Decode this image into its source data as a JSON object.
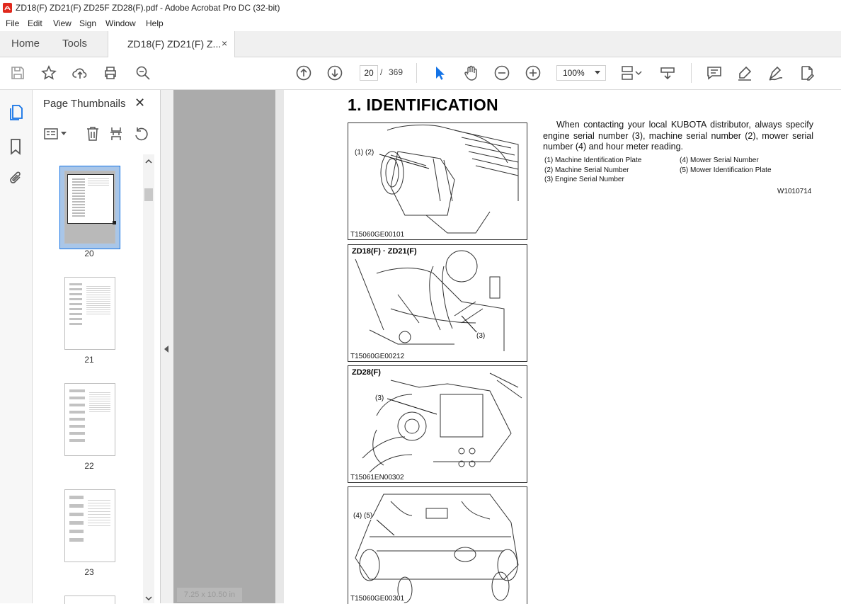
{
  "window": {
    "title": "ZD18(F) ZD21(F) ZD25F ZD28(F).pdf - Adobe Acrobat Pro DC (32-bit)"
  },
  "menu": [
    "File",
    "Edit",
    "View",
    "Sign",
    "Window",
    "Help"
  ],
  "tabs": {
    "home": "Home",
    "tools": "Tools",
    "document": "ZD18(F) ZD21(F) Z...",
    "close": "×"
  },
  "toolbar": {
    "current_page": "20",
    "separator": "/",
    "total_pages": "369",
    "zoom": "100%"
  },
  "sidebar": {
    "title": "Page Thumbnails",
    "close": "✕",
    "thumbnails": [
      {
        "label": "20",
        "selected": true
      },
      {
        "label": "21",
        "selected": false
      },
      {
        "label": "22",
        "selected": false
      },
      {
        "label": "23",
        "selected": false
      }
    ]
  },
  "document": {
    "heading": "1.  IDENTIFICATION",
    "intro": "When contacting your local KUBOTA distributor, always specify engine serial number (3), machine serial number (2), mower serial number (4) and hour meter reading.",
    "legend_left": [
      "(1)  Machine Identification Plate",
      "(2)  Machine Serial Number",
      "(3)  Engine Serial Number"
    ],
    "legend_right": [
      "(4)  Mower Serial Number",
      "(5)  Mower Identification Plate"
    ],
    "ref_code": "W1010714",
    "figures": [
      {
        "tag": "",
        "callout": "(1) (2)",
        "caption": "T15060GE00101"
      },
      {
        "tag": "ZD18(F) · ZD21(F)",
        "callout": "(3)",
        "caption": "T15060GE00212"
      },
      {
        "tag": "ZD28(F)",
        "callout": "(3)",
        "caption": "T15061EN00302"
      },
      {
        "tag": "",
        "callout": "(4) (5)",
        "caption": "T15060GE00301"
      }
    ],
    "page_size": "7.25 x 10.50 in"
  },
  "colors": {
    "accent_blue": "#1473e6",
    "pdf_red": "#e0281c",
    "doc_background": "#ababab"
  }
}
